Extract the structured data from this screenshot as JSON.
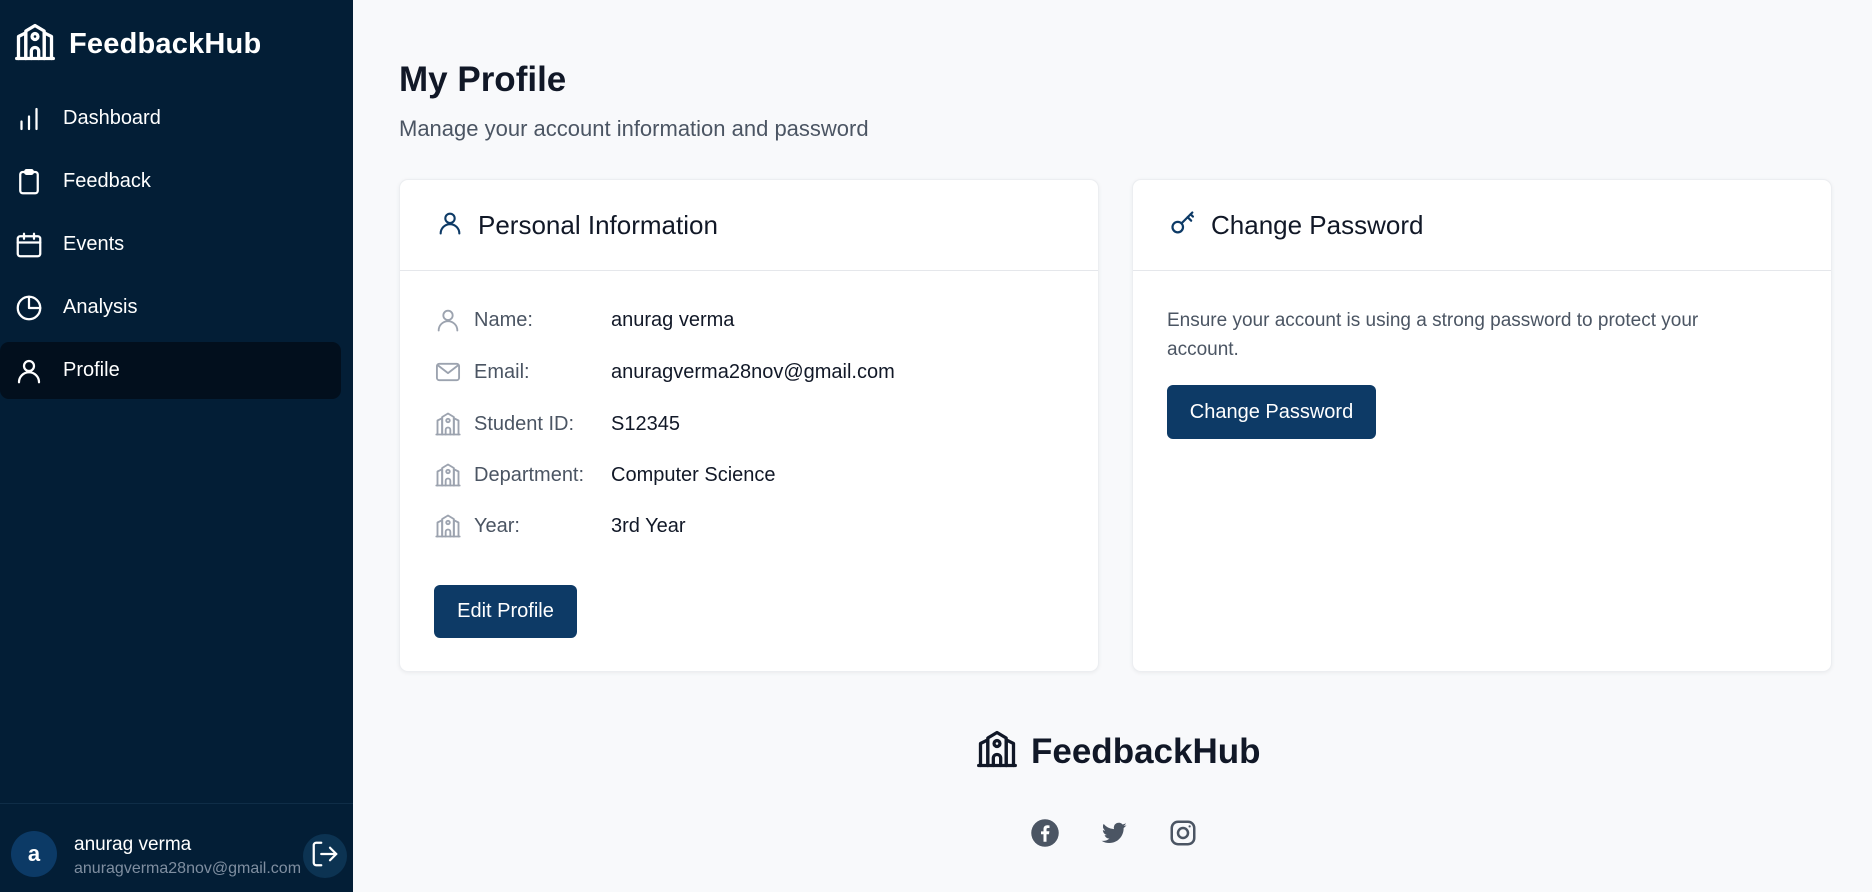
{
  "sidebar": {
    "brand": "FeedbackHub",
    "items": [
      {
        "label": "Dashboard",
        "icon": "bar-chart-icon"
      },
      {
        "label": "Feedback",
        "icon": "clipboard-icon"
      },
      {
        "label": "Events",
        "icon": "calendar-icon"
      },
      {
        "label": "Analysis",
        "icon": "pie-chart-icon"
      },
      {
        "label": "Profile",
        "icon": "user-icon",
        "active": true
      }
    ],
    "user": {
      "initial": "a",
      "name": "anurag verma",
      "email": "anuragverma28nov@gmail.com"
    }
  },
  "main": {
    "title": "My Profile",
    "subtitle": "Manage your account information and password",
    "personal": {
      "title": "Personal Information",
      "rows": [
        {
          "key": "Name:",
          "value": "anurag verma",
          "icon": "user-icon"
        },
        {
          "key": "Email:",
          "value": "anuragverma28nov@gmail.com",
          "icon": "mail-icon"
        },
        {
          "key": "Student ID:",
          "value": "S12345",
          "icon": "school-icon"
        },
        {
          "key": "Department:",
          "value": "Computer Science",
          "icon": "school-icon"
        },
        {
          "key": "Year:",
          "value": "3rd Year",
          "icon": "school-icon"
        }
      ],
      "edit_button": "Edit Profile"
    },
    "password": {
      "title": "Change Password",
      "description": "Ensure your account is using a strong password to protect your account.",
      "button": "Change Password"
    }
  },
  "footer": {
    "brand": "FeedbackHub",
    "socials": [
      "facebook-icon",
      "twitter-icon",
      "instagram-icon"
    ]
  },
  "colors": {
    "sidebar_bg": "#031e36",
    "active_bg": "#020f1d",
    "primary": "#0d3a66",
    "page_bg": "#f8f9fb"
  }
}
